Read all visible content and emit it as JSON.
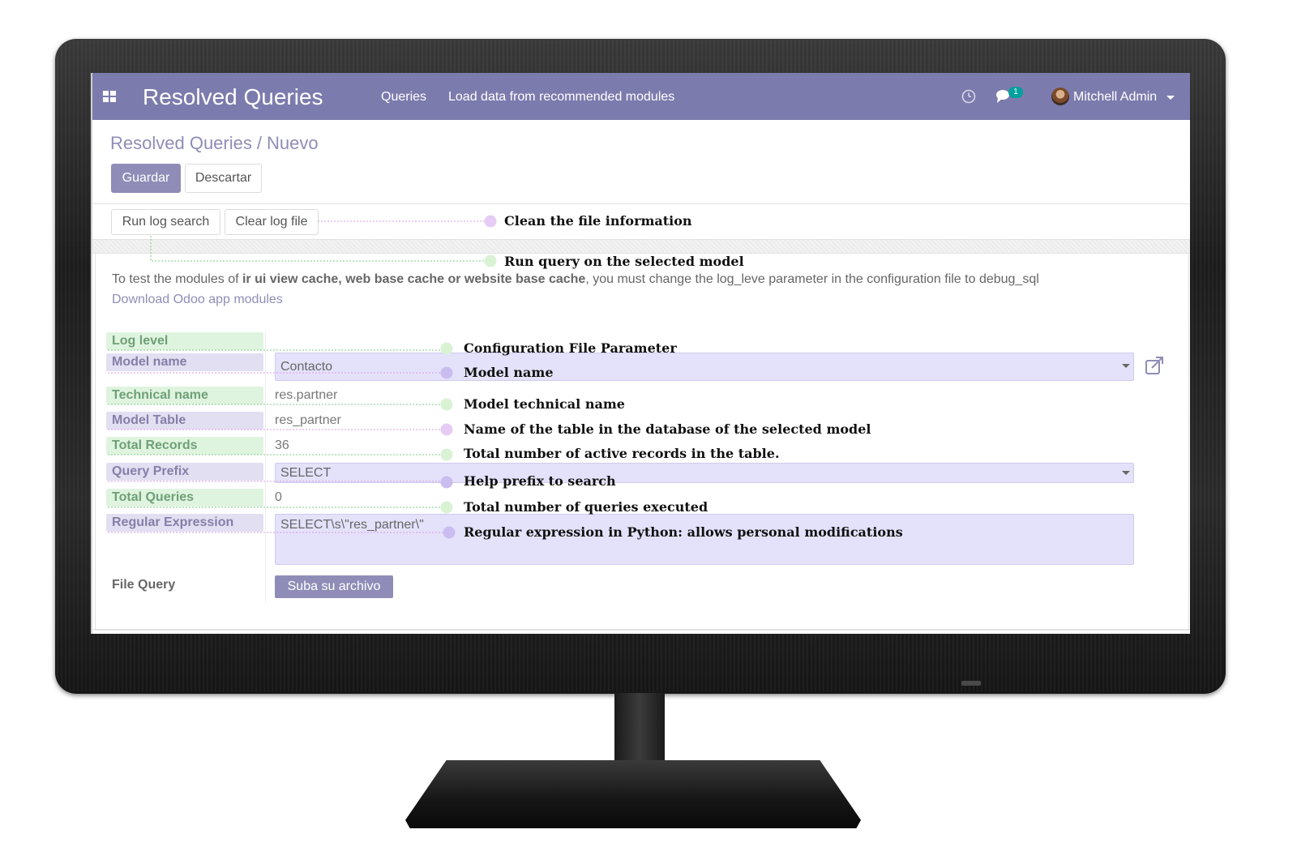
{
  "navbar": {
    "app_title": "Resolved Queries",
    "menu": [
      "Queries",
      "Load data from recommended modules"
    ],
    "chat_count": "1",
    "user": "Mitchell Admin"
  },
  "breadcrumb": {
    "parent": "Resolved Queries",
    "sep": "/",
    "current": "Nuevo"
  },
  "buttons": {
    "save": "Guardar",
    "discard": "Descartar",
    "run_log": "Run log search",
    "clear_log": "Clear log file",
    "upload": "Suba su archivo"
  },
  "info": {
    "text_before": "To test the modules of ",
    "text_bold": "ir ui view cache, web base cache or website base cache",
    "text_after": ", you must change the log_leve parameter in the configuration file to debug_sql",
    "link": "Download Odoo app modules"
  },
  "fields": {
    "log_level": {
      "label": "Log level"
    },
    "model_name": {
      "label": "Model name",
      "value": "Contacto"
    },
    "technical_name": {
      "label": "Technical name",
      "value": "res.partner"
    },
    "model_table": {
      "label": "Model Table",
      "value": "res_partner"
    },
    "total_records": {
      "label": "Total Records",
      "value": "36"
    },
    "query_prefix": {
      "label": "Query Prefix",
      "value": "SELECT"
    },
    "total_queries": {
      "label": "Total Queries",
      "value": "0"
    },
    "regex": {
      "label": "Regular Expression",
      "value": "SELECT\\s\\\"res_partner\\\""
    },
    "file_query": {
      "label": "File Query"
    }
  },
  "annotations": {
    "clear_log": "Clean the file information",
    "run_log": "Run query on the selected model",
    "log_level": "Configuration File Parameter",
    "model_name": "Model name",
    "technical_name": "Model technical name",
    "model_table": "Name of the table in the database of the selected model",
    "total_records": "Total number of active records in the table.",
    "query_prefix": "Help prefix to search",
    "total_queries": "Total number of queries executed",
    "regex": "Regular expression in Python: allows personal modifications"
  },
  "colors": {
    "navbar": "#7c7bad",
    "primary": "#8f8db7",
    "green_highlight": "#dff4df",
    "purple_highlight": "#e3dff2",
    "input_highlight": "#e4e2fa",
    "badge": "#00a09d"
  }
}
